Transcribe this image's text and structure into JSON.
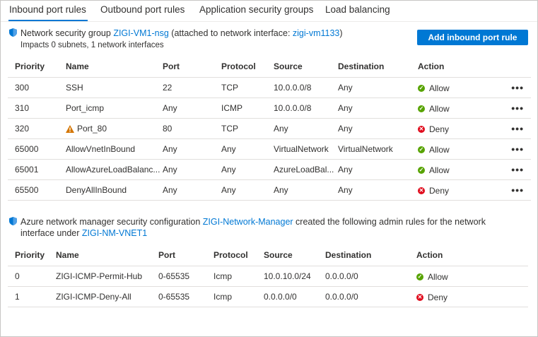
{
  "tabs": [
    {
      "label": "Inbound port rules",
      "active": true
    },
    {
      "label": "Outbound port rules"
    },
    {
      "label": "Application security groups"
    },
    {
      "label": "Load balancing"
    }
  ],
  "nsg": {
    "prefix": "Network security group ",
    "nsg_name": "ZIGI-VM1-nsg",
    "middle": " (attached to network interface: ",
    "nic_name": "zigi-vm1133",
    "suffix": ")",
    "impacts": "Impacts 0 subnets, 1 network interfaces",
    "add_button": "Add inbound port rule"
  },
  "inbound_table": {
    "headers": [
      "Priority",
      "Name",
      "Port",
      "Protocol",
      "Source",
      "Destination",
      "Action"
    ],
    "rows": [
      {
        "priority": "300",
        "name": "SSH",
        "warning": false,
        "port": "22",
        "protocol": "TCP",
        "source": "10.0.0.0/8",
        "destination": "Any",
        "action": "Allow"
      },
      {
        "priority": "310",
        "name": "Port_icmp",
        "warning": false,
        "port": "Any",
        "protocol": "ICMP",
        "source": "10.0.0.0/8",
        "destination": "Any",
        "action": "Allow"
      },
      {
        "priority": "320",
        "name": "Port_80",
        "warning": true,
        "port": "80",
        "protocol": "TCP",
        "source": "Any",
        "destination": "Any",
        "action": "Deny"
      },
      {
        "priority": "65000",
        "name": "AllowVnetInBound",
        "warning": false,
        "port": "Any",
        "protocol": "Any",
        "source": "VirtualNetwork",
        "destination": "VirtualNetwork",
        "action": "Allow"
      },
      {
        "priority": "65001",
        "name": "AllowAzureLoadBalanc...",
        "warning": false,
        "port": "Any",
        "protocol": "Any",
        "source": "AzureLoadBal...",
        "destination": "Any",
        "action": "Allow"
      },
      {
        "priority": "65500",
        "name": "DenyAllInBound",
        "warning": false,
        "port": "Any",
        "protocol": "Any",
        "source": "Any",
        "destination": "Any",
        "action": "Deny"
      }
    ],
    "more_label": "•••"
  },
  "network_manager": {
    "prefix": "Azure network manager security configuration ",
    "manager_name": "ZIGI-Network-Manager",
    "middle": " created the following admin rules for the network",
    "line2_prefix": "interface under ",
    "vnet_name": "ZIGI-NM-VNET1"
  },
  "admin_table": {
    "headers": [
      "Priority",
      "Name",
      "Port",
      "Protocol",
      "Source",
      "Destination",
      "Action"
    ],
    "rows": [
      {
        "priority": "0",
        "name": "ZIGI-ICMP-Permit-Hub",
        "port": "0-65535",
        "protocol": "Icmp",
        "source": "10.0.10.0/24",
        "destination": "0.0.0.0/0",
        "action": "Allow"
      },
      {
        "priority": "1",
        "name": "ZIGI-ICMP-Deny-All",
        "port": "0-65535",
        "protocol": "Icmp",
        "source": "0.0.0.0/0",
        "destination": "0.0.0.0/0",
        "action": "Deny"
      }
    ]
  },
  "colors": {
    "accent": "#0078d4",
    "allow": "#57a300",
    "deny": "#e00b1c",
    "warning": "#d47500"
  }
}
